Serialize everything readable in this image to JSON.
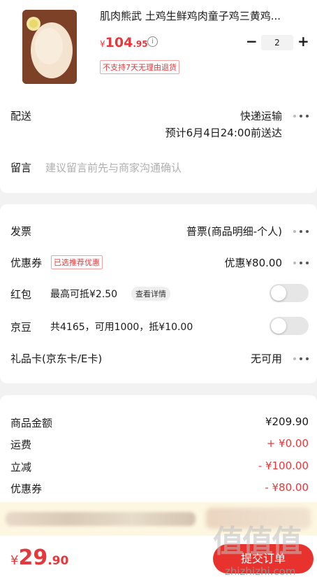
{
  "product": {
    "title": "肌肉熊武 土鸡生鲜鸡肉童子鸡三黄鸡...",
    "price_currency": "¥",
    "price_integer": "104",
    "price_decimal": ".95",
    "info_icon": "i",
    "quantity": "2",
    "minus": "−",
    "plus": "+",
    "return_policy": "不支持7天无理由退货"
  },
  "delivery": {
    "label": "配送",
    "method": "快递运输",
    "eta": "预计6月4日24:00前送达"
  },
  "note": {
    "label": "留言",
    "placeholder": "建议留言前先与商家沟通确认"
  },
  "invoice": {
    "label": "发票",
    "value": "普票(商品明细-个人)"
  },
  "coupon": {
    "label": "优惠券",
    "tag": "已选推荐优惠",
    "value": "优惠¥80.00"
  },
  "red_packet": {
    "label": "红包",
    "desc": "最高可抵¥2.50",
    "detail_button": "查看详情",
    "enabled": false
  },
  "jd_beans": {
    "label": "京豆",
    "desc": "共4165，可用1000，抵¥10.00",
    "enabled": false
  },
  "gift_card": {
    "label": "礼品卡(京东卡/E卡)",
    "value": "无可用"
  },
  "summary": {
    "goods_label": "商品金额",
    "goods_value": "¥209.90",
    "shipping_label": "运费",
    "shipping_value": "+ ¥0.00",
    "discount_label": "立减",
    "discount_value": "- ¥100.00",
    "coupon_label": "优惠券",
    "coupon_value": "- ¥80.00"
  },
  "footer": {
    "total_currency": "¥",
    "total_integer": "29",
    "total_decimal": ".90",
    "submit_label": "提交订单"
  },
  "watermark": {
    "text": "值值值",
    "url": "zhizhizhi.com"
  },
  "colors": {
    "accent": "#e4393c",
    "submit": "#e8322e",
    "notice_bg": "#fdf6e0"
  }
}
